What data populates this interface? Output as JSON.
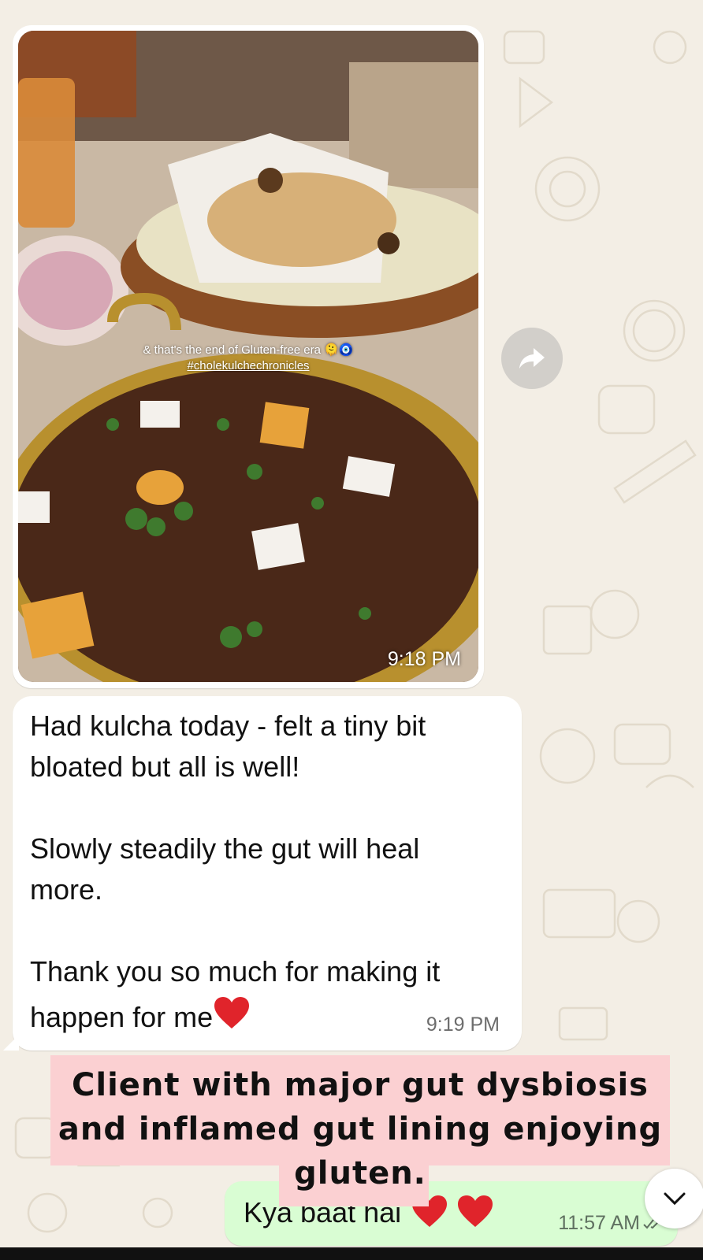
{
  "photo_message": {
    "caption_line1": "& that's  the end of Gluten-free era 🫠🧿",
    "caption_line2": "#cholekulchechronicles",
    "time": "9:18 PM"
  },
  "forward_icon": "forward-arrow-icon",
  "text_message": {
    "lines": [
      "Had kulcha today - felt a tiny bit",
      "bloated but all is well!",
      "Slowly steadily the gut will heal",
      "more.",
      "Thank you so much for making it",
      "happen for me"
    ],
    "time": "9:19 PM"
  },
  "reply_message": {
    "text": "Kya baat hai",
    "time": "11:57 AM"
  },
  "overlay": {
    "line1": "Client with major gut dysbiosis",
    "line2": "and inflamed gut lining enjoying",
    "line3": "gluten."
  },
  "scroll_button_icon": "chevron-down-icon",
  "colors": {
    "wallpaper": "#F3EEE5",
    "incoming_bubble": "#FFFFFF",
    "outgoing_bubble": "#D9FDD3",
    "overlay_highlight": "#FBD0D2",
    "heart": "#E0242B"
  }
}
